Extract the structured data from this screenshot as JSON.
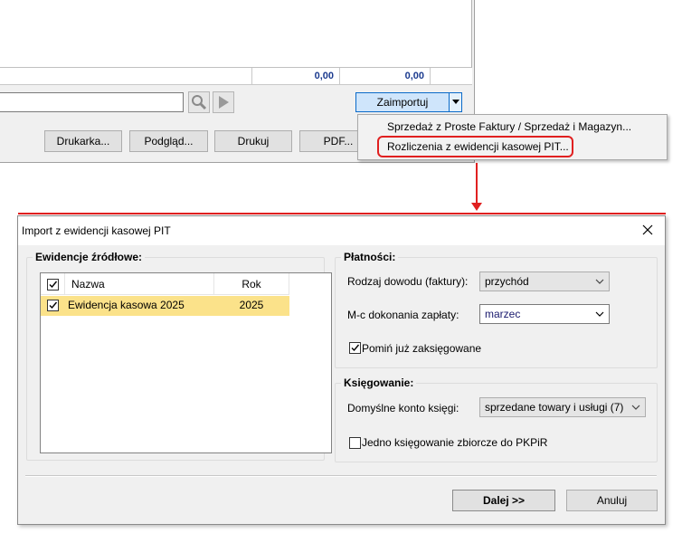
{
  "background_window": {
    "sum_values": [
      "0,00",
      "0,00"
    ],
    "buttons": {
      "printer": "Drukarka...",
      "preview": "Podgląd...",
      "print": "Drukuj",
      "pdf": "PDF..."
    },
    "import_button": "Zaimportuj",
    "dropdown_menu": [
      "Sprzedaż z Proste Faktury / Sprzedaż i Magazyn...",
      "Rozliczenia z ewidencji kasowej PIT..."
    ]
  },
  "dialog": {
    "title": "Import z ewidencji kasowej PIT",
    "sources_group": {
      "legend": "Ewidencje źródłowe:",
      "columns": [
        "Nazwa",
        "Rok"
      ],
      "rows": [
        {
          "name": "Ewidencja kasowa 2025",
          "year": "2025",
          "checked": true
        }
      ]
    },
    "payments_group": {
      "legend": "Płatności:",
      "doc_type_label": "Rodzaj dowodu (faktury):",
      "doc_type_value": "przychód",
      "month_label": "M-c dokonania zapłaty:",
      "month_value": "marzec",
      "skip_posted_label": "Pomiń już zaksięgowane",
      "skip_posted_checked": true
    },
    "posting_group": {
      "legend": "Księgowanie:",
      "account_label": "Domyślne konto księgi:",
      "account_value": "sprzedane towary i usługi (7)",
      "single_posting_label": "Jedno księgowanie zbiorcze do PKPiR",
      "single_posting_checked": false
    },
    "next_button": "Dalej >>",
    "cancel_button": "Anuluj"
  },
  "colors": {
    "highlight_red": "#e02020",
    "selected_row": "#fbe28a",
    "sum_text": "#1c3b8f"
  }
}
